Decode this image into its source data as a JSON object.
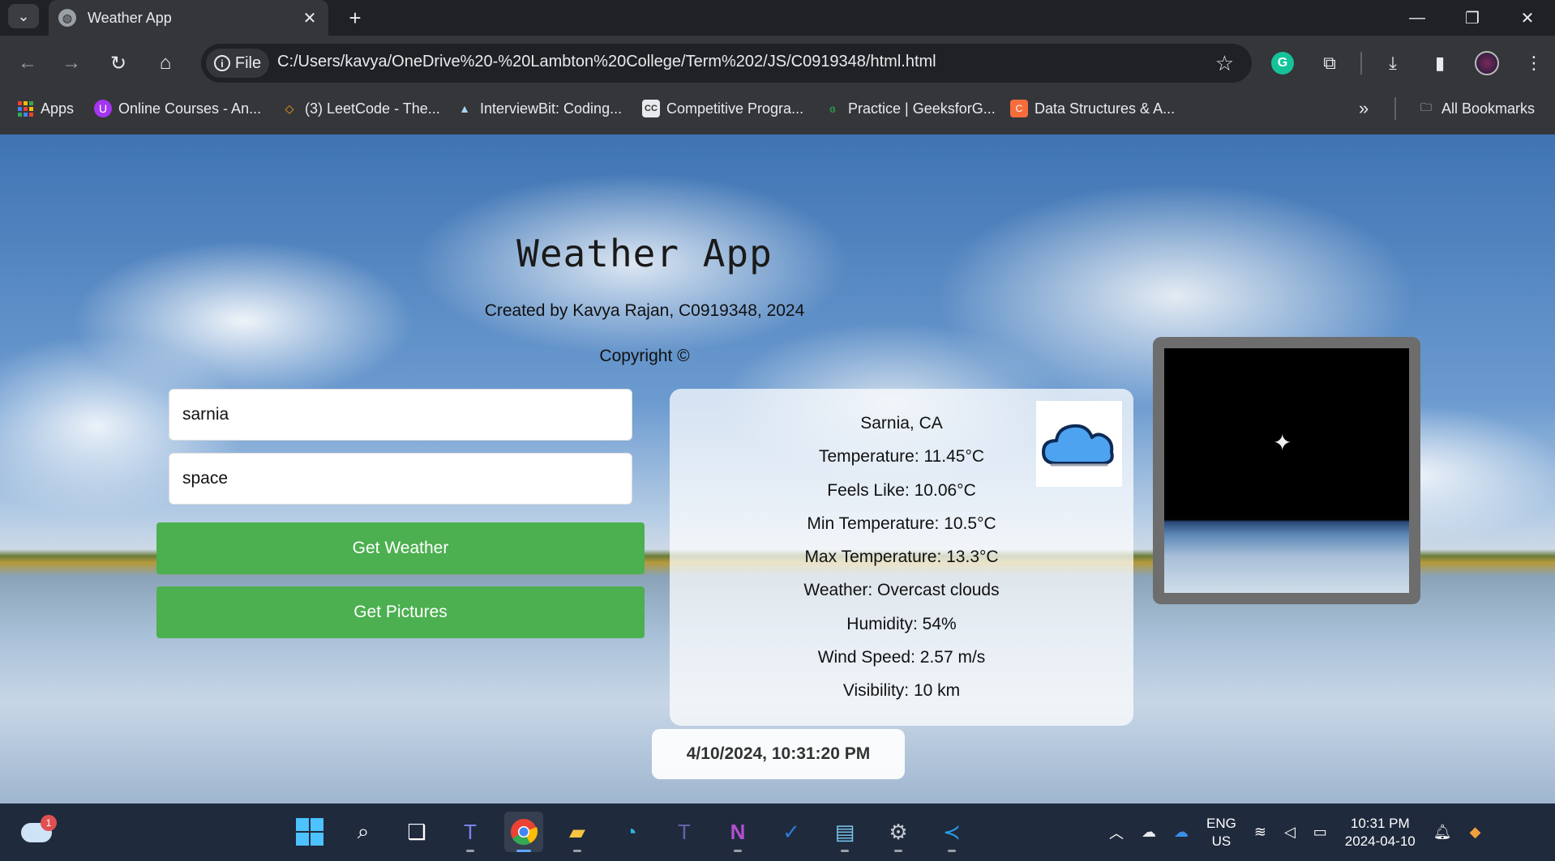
{
  "browser": {
    "tab_title": "Weather App",
    "url_scheme_label": "File",
    "url": "C:/Users/kavya/OneDrive%20-%20Lambton%20College/Term%202/JS/C0919348/html.html",
    "bookmarks": [
      {
        "label": "Apps",
        "icon": "apps-grid-icon"
      },
      {
        "label": "Online Courses - An...",
        "icon": "udemy-icon"
      },
      {
        "label": "(3) LeetCode - The...",
        "icon": "leetcode-icon"
      },
      {
        "label": "InterviewBit: Coding...",
        "icon": "interviewbit-icon"
      },
      {
        "label": "Competitive Progra...",
        "icon": "codechef-icon"
      },
      {
        "label": "Practice | GeeksforG...",
        "icon": "geeksforgeeks-icon"
      },
      {
        "label": "Data Structures & A...",
        "icon": "codingninjas-icon"
      }
    ],
    "all_bookmarks_label": "All Bookmarks"
  },
  "page": {
    "title": "Weather App",
    "credit": "Created by Kavya Rajan, C0919348, 2024",
    "copyright": "Copyright ©",
    "city_input_value": "sarnia",
    "query_input_value": "space",
    "get_weather_label": "Get Weather",
    "get_pictures_label": "Get Pictures",
    "weather": {
      "location": "Sarnia, CA",
      "temperature": "Temperature: 11.45°C",
      "feels_like": "Feels Like: 10.06°C",
      "min_temp": "Min Temperature: 10.5°C",
      "max_temp": "Max Temperature: 13.3°C",
      "condition": "Weather: Overcast clouds",
      "humidity": "Humidity: 54%",
      "wind_speed": "Wind Speed: 2.57 m/s",
      "visibility": "Visibility: 10 km",
      "icon": "cloud-icon"
    },
    "datetime": "4/10/2024, 10:31:20 PM"
  },
  "taskbar": {
    "weather_badge": "1",
    "lang_line1": "ENG",
    "lang_line2": "US",
    "time": "10:31 PM",
    "date": "2024-04-10"
  },
  "colors": {
    "button_green": "#4caf50",
    "chrome_dark": "#202124",
    "chrome_toolbar": "#35363a",
    "taskbar": "#1f2a3d"
  }
}
